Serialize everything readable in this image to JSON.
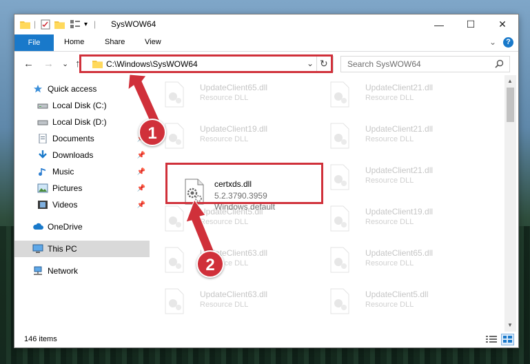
{
  "window": {
    "title": "SysWOW64"
  },
  "window_buttons": {
    "minimize": "—",
    "maximize": "☐",
    "close": "✕"
  },
  "ribbon": {
    "file": "File",
    "tabs": [
      "Home",
      "Share",
      "View"
    ],
    "collapse": "⌄",
    "help": "?"
  },
  "nav": {
    "back": "←",
    "forward": "→",
    "recent": "⌄",
    "up": "↑",
    "address": "C:\\Windows\\SysWOW64",
    "dropdown": "⌄",
    "refresh": "↻",
    "search_placeholder": "Search SysWOW64"
  },
  "sidebar": {
    "items": [
      {
        "label": "Quick access",
        "icon": "star-icon"
      },
      {
        "label": "Local Disk (C:)",
        "icon": "drive-icon"
      },
      {
        "label": "Local Disk (D:)",
        "icon": "drive-icon"
      },
      {
        "label": "Documents",
        "icon": "documents-icon"
      },
      {
        "label": "Downloads",
        "icon": "download-icon"
      },
      {
        "label": "Music",
        "icon": "music-icon"
      },
      {
        "label": "Pictures",
        "icon": "pictures-icon"
      },
      {
        "label": "Videos",
        "icon": "videos-icon"
      },
      {
        "label": "OneDrive",
        "icon": "cloud-icon"
      },
      {
        "label": "This PC",
        "icon": "computer-icon"
      },
      {
        "label": "Network",
        "icon": "network-icon"
      }
    ]
  },
  "files": {
    "featured": {
      "name": "certxds.dll",
      "version": "5.2.3790.3959",
      "company": "Windows default"
    },
    "ghosts": [
      {
        "name": "UpdateClient65.dll",
        "type": "Resource DLL"
      },
      {
        "name": "UpdateClient21.dll",
        "type": "Resource DLL"
      },
      {
        "name": "UpdateClient19.dll",
        "type": "Resource DLL"
      },
      {
        "name": "UpdateClient21.dll",
        "type": "Resource DLL"
      },
      {
        "name": "UpdateClient21.dll",
        "type": "Resource DLL"
      },
      {
        "name": "UpdateClient5.dll",
        "type": "Resource DLL"
      },
      {
        "name": "UpdateClient19.dll",
        "type": "Resource DLL"
      },
      {
        "name": "UpdateClient63.dll",
        "type": "Resource DLL"
      },
      {
        "name": "UpdateClient65.dll",
        "type": "Resource DLL"
      },
      {
        "name": "UpdateClient63.dll",
        "type": "Resource DLL"
      },
      {
        "name": "UpdateClient5.dll",
        "type": "Resource DLL"
      }
    ]
  },
  "status": {
    "items": "146 items"
  },
  "annotations": {
    "step1": "1",
    "step2": "2",
    "color": "#d0303a"
  },
  "colors": {
    "accent": "#1979ca"
  }
}
